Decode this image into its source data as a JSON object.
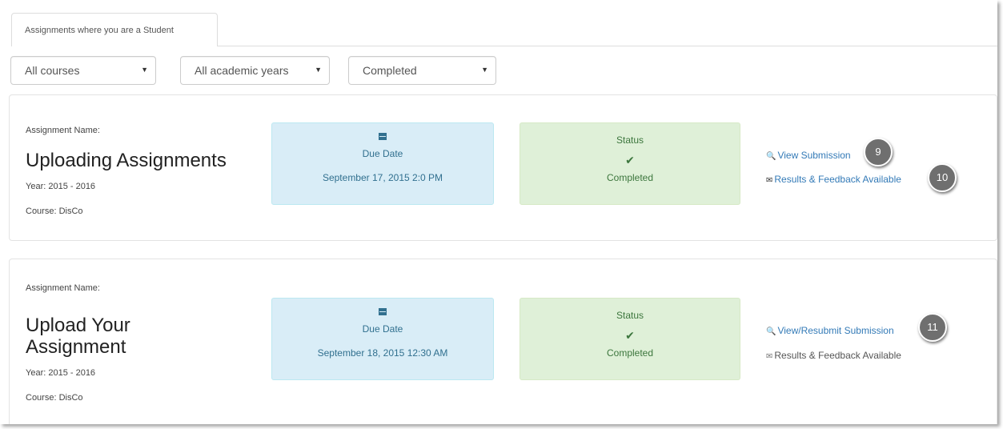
{
  "tab": {
    "label": "Assignments where you are a Student"
  },
  "filters": {
    "course": "All courses",
    "year": "All academic years",
    "status": "Completed",
    "caret": "▼"
  },
  "assignments": [
    {
      "name_label": "Assignment Name:",
      "name": "Uploading Assignments",
      "year": "Year: 2015 - 2016",
      "course": "Course: DisCo",
      "due_label": "Due Date",
      "due_date": "September 17, 2015 2:0 PM",
      "status_label": "Status",
      "status": "Completed",
      "check": "✔",
      "action1": "View Submission",
      "action2": "Results & Feedback Available",
      "callout1": "9",
      "callout2": "10"
    },
    {
      "name_label": "Assignment Name:",
      "name": "Upload Your Assignment",
      "year": "Year: 2015 - 2016",
      "course": "Course: DisCo",
      "due_label": "Due Date",
      "due_date": "September 18, 2015 12:30 AM",
      "status_label": "Status",
      "status": "Completed",
      "check": "✔",
      "action1": "View/Resubmit Submission",
      "action2": "Results & Feedback Available",
      "callout1": "11"
    }
  ],
  "icons": {
    "magnify": "magnifier-icon",
    "envelope": "envelope-icon",
    "calendar": "calendar-icon"
  }
}
